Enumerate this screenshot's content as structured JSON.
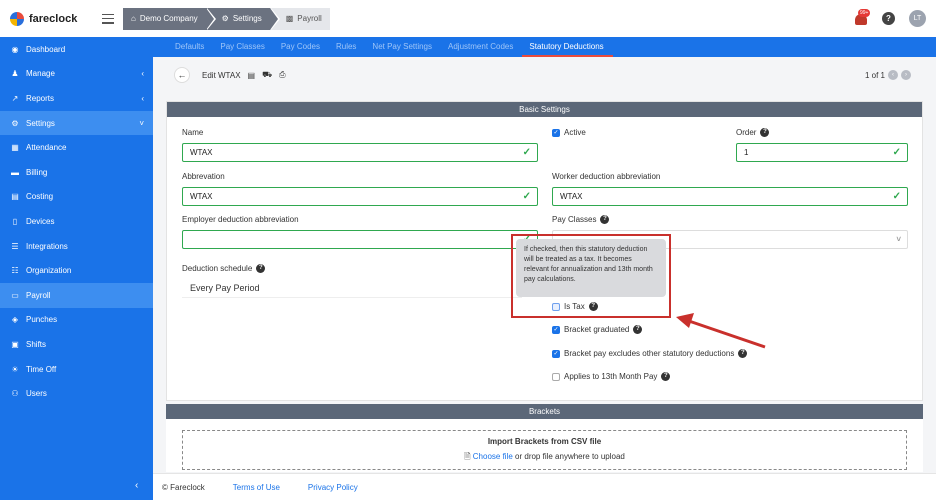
{
  "app": {
    "name": "fareclock"
  },
  "breadcrumbs": [
    "Demo Company",
    "Settings",
    "Payroll"
  ],
  "topbar": {
    "notif_badge": "99+",
    "help": "?",
    "user_initials": "LT"
  },
  "sidebar": {
    "items": [
      {
        "label": "Dashboard",
        "icon": "◉"
      },
      {
        "label": "Manage",
        "icon": "♟",
        "chevron": "‹"
      },
      {
        "label": "Reports",
        "icon": "↗",
        "chevron": "‹"
      },
      {
        "label": "Settings",
        "icon": "⚙",
        "chevron": "˅"
      },
      {
        "label": "Attendance",
        "icon": "▦"
      },
      {
        "label": "Billing",
        "icon": "▬"
      },
      {
        "label": "Costing",
        "icon": "▤"
      },
      {
        "label": "Devices",
        "icon": "▯"
      },
      {
        "label": "Integrations",
        "icon": "☰"
      },
      {
        "label": "Organization",
        "icon": "☷"
      },
      {
        "label": "Payroll",
        "icon": "▭"
      },
      {
        "label": "Punches",
        "icon": "◈"
      },
      {
        "label": "Shifts",
        "icon": "▣"
      },
      {
        "label": "Time Off",
        "icon": "☀"
      },
      {
        "label": "Users",
        "icon": "⚇"
      }
    ],
    "collapse": "‹"
  },
  "tabs": [
    "Defaults",
    "Pay Classes",
    "Pay Codes",
    "Rules",
    "Net Pay Settings",
    "Adjustment Codes",
    "Statutory Deductions"
  ],
  "toolbar": {
    "back": "←",
    "title": "Edit WTAX",
    "pager": "1 of 1",
    "prev": "‹",
    "next": "›"
  },
  "form": {
    "section": "Basic Settings",
    "name_label": "Name",
    "name_value": "WTAX",
    "abbr_label": "Abbrevation",
    "abbr_value": "WTAX",
    "employer_abbr_label": "Employer deduction abbreviation",
    "employer_abbr_value": "",
    "schedule_label": "Deduction schedule",
    "schedule_value": "Every Pay Period",
    "active_label": "Active",
    "order_label": "Order",
    "order_value": "1",
    "worker_abbr_label": "Worker deduction abbreviation",
    "worker_abbr_value": "WTAX",
    "pay_classes_label": "Pay Classes",
    "is_tax_label": "Is Tax",
    "bracket_grad_label": "Bracket graduated",
    "bracket_excl_label": "Bracket pay excludes other statutory deductions",
    "thirteenth_label": "Applies to 13th Month Pay",
    "tooltip": "If checked, then this statutory deduction will be treated as a tax. It becomes relevant for annualization and 13th month pay calculations."
  },
  "brackets": {
    "section": "Brackets",
    "import_title": "Import Brackets from CSV file",
    "choose_file": "Choose file",
    "drop_text": "or drop file anywhere to upload"
  },
  "footer": {
    "copyright": "© Fareclock",
    "terms": "Terms of Use",
    "privacy": "Privacy Policy"
  },
  "colors": {
    "primary": "#1a73e8",
    "success": "#2fa84f",
    "annotation": "#c9302c",
    "header": "#5b6778"
  }
}
